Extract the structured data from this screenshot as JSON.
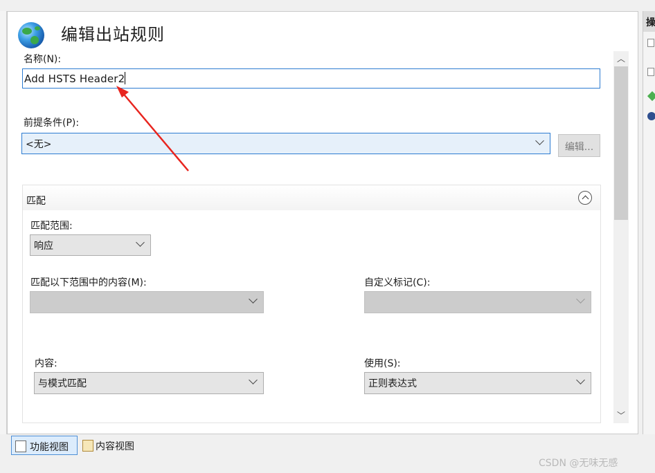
{
  "dialog": {
    "title": "编辑出站规则"
  },
  "fields": {
    "name_label": "名称(N):",
    "name_value": "Add HSTS Header2",
    "precondition_label": "前提条件(P):",
    "precondition_value": "<无>",
    "edit_button": "编辑..."
  },
  "match": {
    "section_title": "匹配",
    "scope_label": "匹配范围:",
    "scope_value": "响应",
    "match_content_label": "匹配以下范围中的内容(M):",
    "match_content_value": "",
    "custom_tag_label": "自定义标记(C):",
    "custom_tag_value": "",
    "content_label": "内容:",
    "content_value": "与模式匹配",
    "using_label": "使用(S):",
    "using_value": "正则表达式"
  },
  "bottom_tabs": [
    {
      "label": "功能视图",
      "icon": "feature-view-icon",
      "selected": true
    },
    {
      "label": "内容视图",
      "icon": "content-view-icon",
      "selected": false
    }
  ],
  "watermark": "CSDN @无味无感",
  "colors": {
    "accent_border": "#2b7bd1",
    "annotation_arrow": "#e8251f"
  }
}
